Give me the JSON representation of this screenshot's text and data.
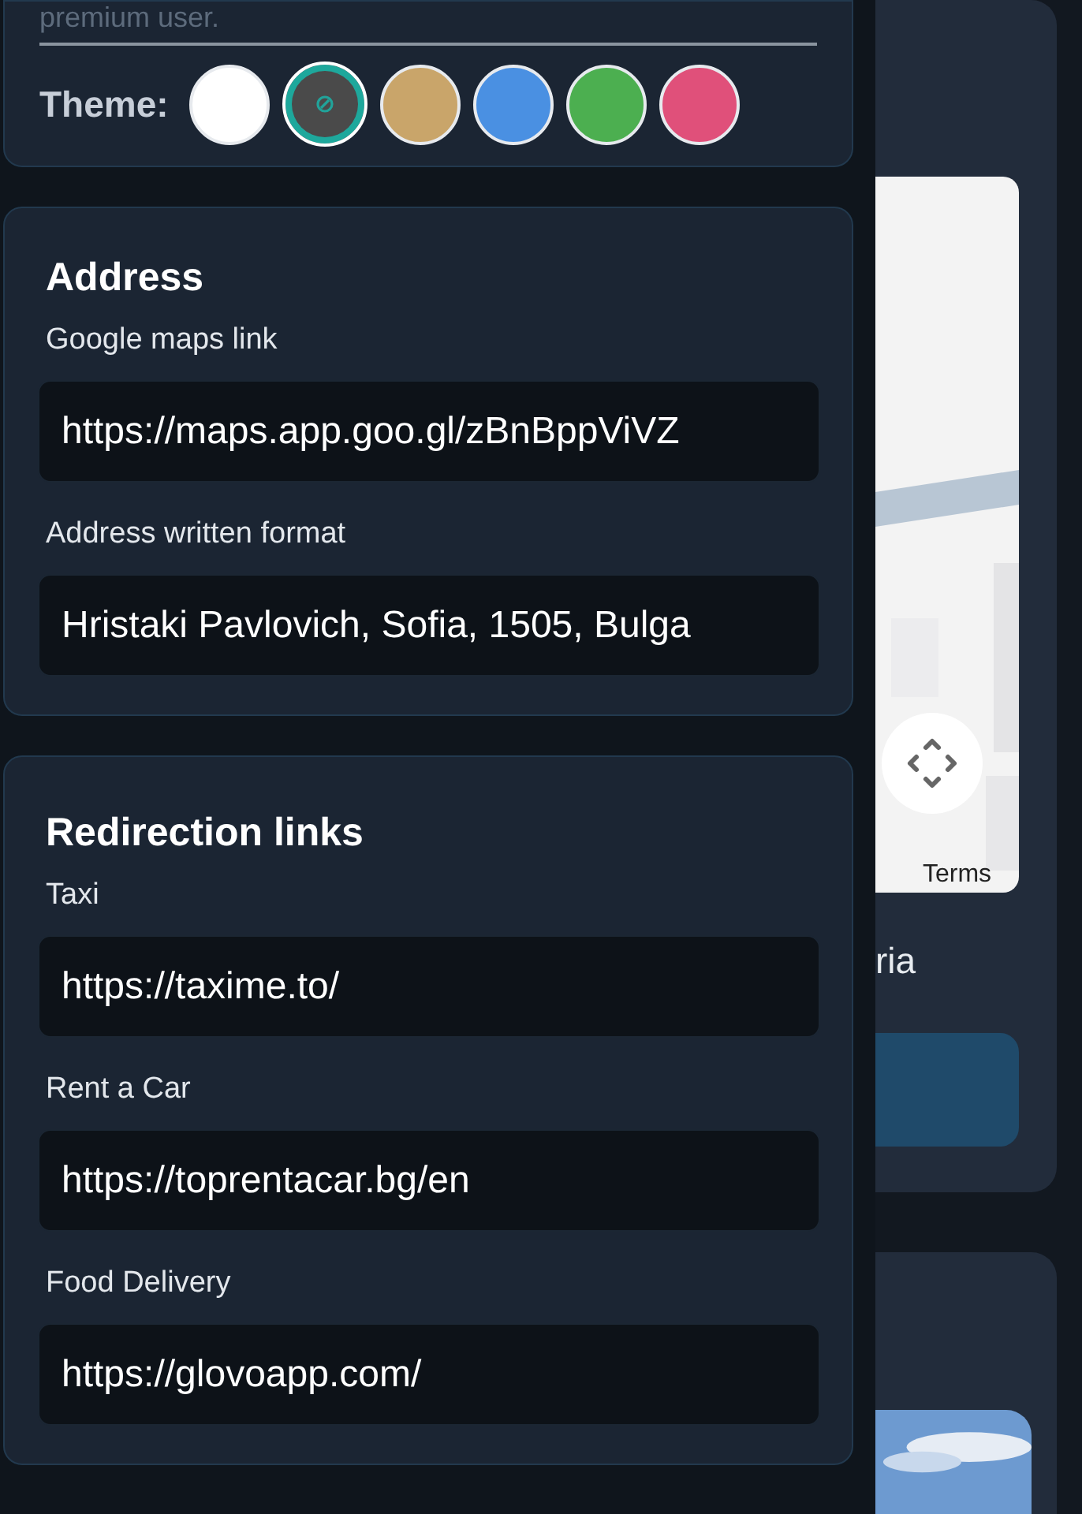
{
  "profile_card": {
    "note": "premium user.",
    "theme_label": "Theme:",
    "themes": [
      {
        "color": "#ffffff",
        "selected": false
      },
      {
        "color": "#4a4a4a",
        "selected": true
      },
      {
        "color": "#c9a56a",
        "selected": false
      },
      {
        "color": "#4a90e2",
        "selected": false
      },
      {
        "color": "#4caf50",
        "selected": false
      },
      {
        "color": "#e0507a",
        "selected": false
      }
    ]
  },
  "address": {
    "title": "Address",
    "fields": [
      {
        "label": "Google maps link",
        "value": "https://maps.app.goo.gl/zBnBppViVZ"
      },
      {
        "label": "Address written format",
        "value": "Hristaki Pavlovich, Sofia, 1505, Bulga"
      }
    ]
  },
  "redirection": {
    "title": "Redirection links",
    "fields": [
      {
        "label": "Taxi",
        "value": "https://taxime.to/"
      },
      {
        "label": "Rent a Car",
        "value": "https://toprentacar.bg/en"
      },
      {
        "label": "Food Delivery",
        "value": "https://glovoapp.com/"
      }
    ]
  },
  "background_page": {
    "map_attribution": "Terms",
    "address_tail": "ria"
  }
}
